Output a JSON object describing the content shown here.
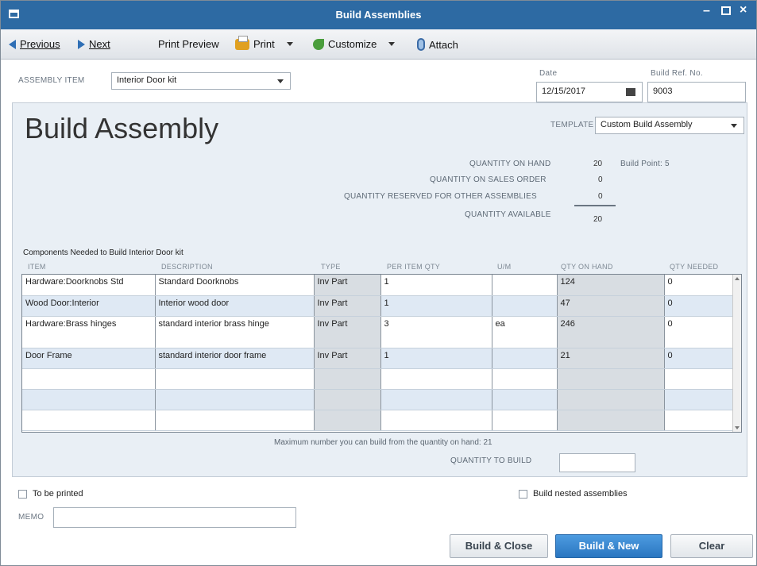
{
  "window": {
    "title": "Build Assemblies"
  },
  "toolbar": {
    "previous": "Previous",
    "next": "Next",
    "print_preview": "Print Preview",
    "print": "Print",
    "customize": "Customize",
    "attach": "Attach"
  },
  "header": {
    "assembly_item_label": "ASSEMBLY ITEM",
    "assembly_item_value": "Interior Door kit",
    "date_label": "Date",
    "date_value": "12/15/2017",
    "build_ref_label": "Build Ref. No.",
    "build_ref_value": "9003"
  },
  "form": {
    "title": "Build Assembly",
    "template_label": "TEMPLATE",
    "template_value": "Custom Build Assembly",
    "qty_on_hand_label": "QUANTITY ON HAND",
    "qty_on_hand_value": "20",
    "build_point": "Build Point: 5",
    "qty_on_sales_order_label": "QUANTITY ON SALES ORDER",
    "qty_on_sales_order_value": "0",
    "qty_reserved_label": "QUANTITY RESERVED FOR OTHER ASSEMBLIES",
    "qty_reserved_value": "0",
    "qty_available_label": "QUANTITY AVAILABLE",
    "qty_available_value": "20"
  },
  "components": {
    "caption": "Components Needed to Build  Interior Door kit",
    "columns": [
      "ITEM",
      "DESCRIPTION",
      "TYPE",
      "PER ITEM QTY",
      "U/M",
      "QTY ON HAND",
      "QTY NEEDED"
    ],
    "rows": [
      [
        "Hardware:Doorknobs Std",
        "Standard Doorknobs",
        "Inv Part",
        "1",
        "",
        "124",
        "0"
      ],
      [
        "Wood Door:Interior",
        "Interior wood door",
        "Inv Part",
        "1",
        "",
        "47",
        "0"
      ],
      [
        "Hardware:Brass hinges",
        "standard interior brass hinge",
        "Inv Part",
        "3",
        "ea",
        "246",
        "0"
      ],
      [
        "Door Frame",
        "standard interior door frame",
        "Inv Part",
        "1",
        "",
        "21",
        "0"
      ],
      [
        "",
        "",
        "",
        "",
        "",
        "",
        ""
      ],
      [
        "",
        "",
        "",
        "",
        "",
        "",
        ""
      ],
      [
        "",
        "",
        "",
        "",
        "",
        "",
        ""
      ]
    ]
  },
  "footer": {
    "max_build_text": "Maximum number you can build from the quantity on hand: 21",
    "qty_to_build_label": "QUANTITY TO BUILD",
    "qty_to_build_value": "",
    "to_be_printed": "To be printed",
    "build_nested": "Build nested assemblies",
    "memo_label": "MEMO",
    "memo_value": ""
  },
  "buttons": {
    "build_close": "Build & Close",
    "build_new": "Build & New",
    "clear": "Clear"
  }
}
